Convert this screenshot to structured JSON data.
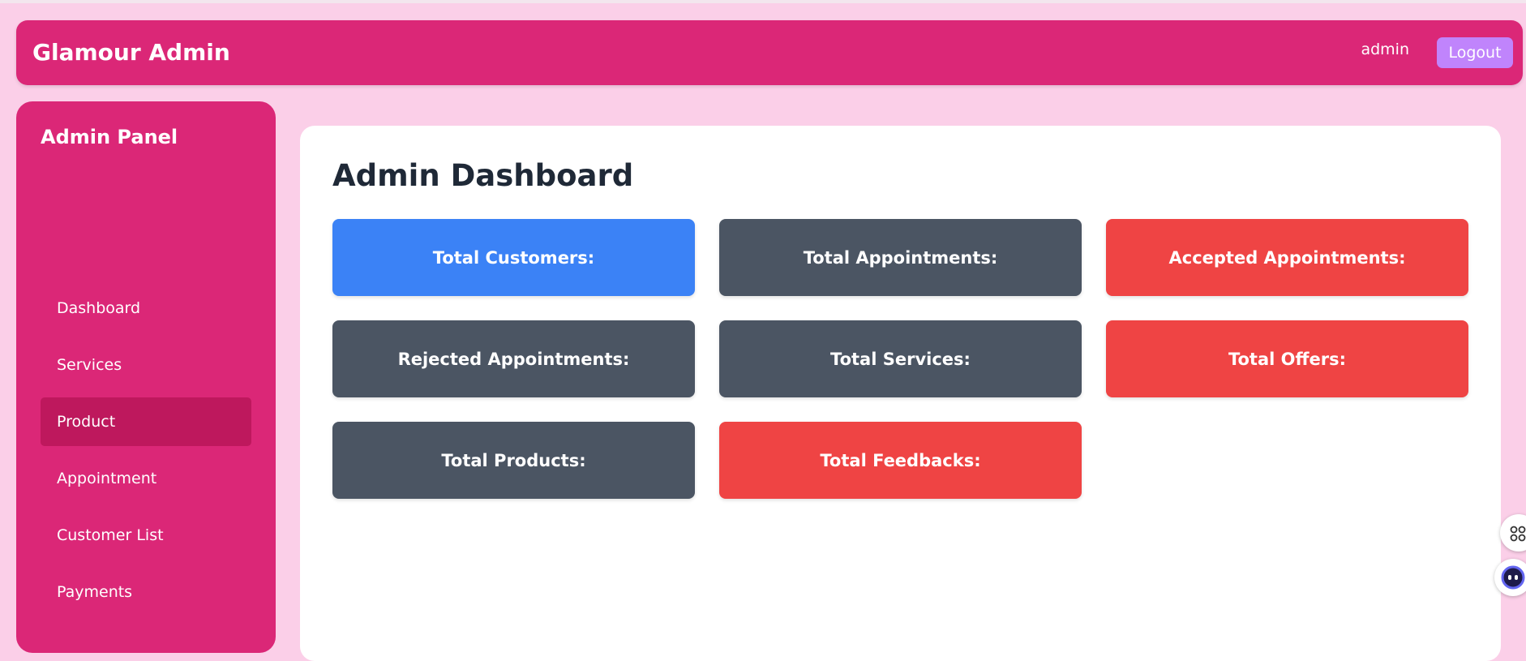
{
  "header": {
    "brand": "Glamour Admin",
    "user": "admin",
    "logout_label": "Logout"
  },
  "sidebar": {
    "title": "Admin Panel",
    "items": [
      {
        "label": "Dashboard",
        "active": false
      },
      {
        "label": "Services",
        "active": false
      },
      {
        "label": "Product",
        "active": true
      },
      {
        "label": "Appointment",
        "active": false
      },
      {
        "label": "Customer List",
        "active": false
      },
      {
        "label": "Payments",
        "active": false
      }
    ]
  },
  "main": {
    "title": "Admin Dashboard",
    "cards": [
      {
        "label": "Total Customers:",
        "color": "#3b82f6"
      },
      {
        "label": "Total Appointments:",
        "color": "#4b5563"
      },
      {
        "label": "Accepted Appointments:",
        "color": "#ef4444"
      },
      {
        "label": "Rejected Appointments:",
        "color": "#4b5563"
      },
      {
        "label": "Total Services:",
        "color": "#4b5563"
      },
      {
        "label": "Total Offers:",
        "color": "#ef4444"
      },
      {
        "label": "Total Products:",
        "color": "#4b5563"
      },
      {
        "label": "Total Feedbacks:",
        "color": "#ef4444"
      }
    ]
  },
  "floating": {
    "icons": [
      "apps-icon",
      "assistant-icon"
    ]
  },
  "colors": {
    "page_bg": "#fbcfe8",
    "primary": "#db2777",
    "active_nav": "#be185d",
    "logout_bg": "#c084fc"
  }
}
